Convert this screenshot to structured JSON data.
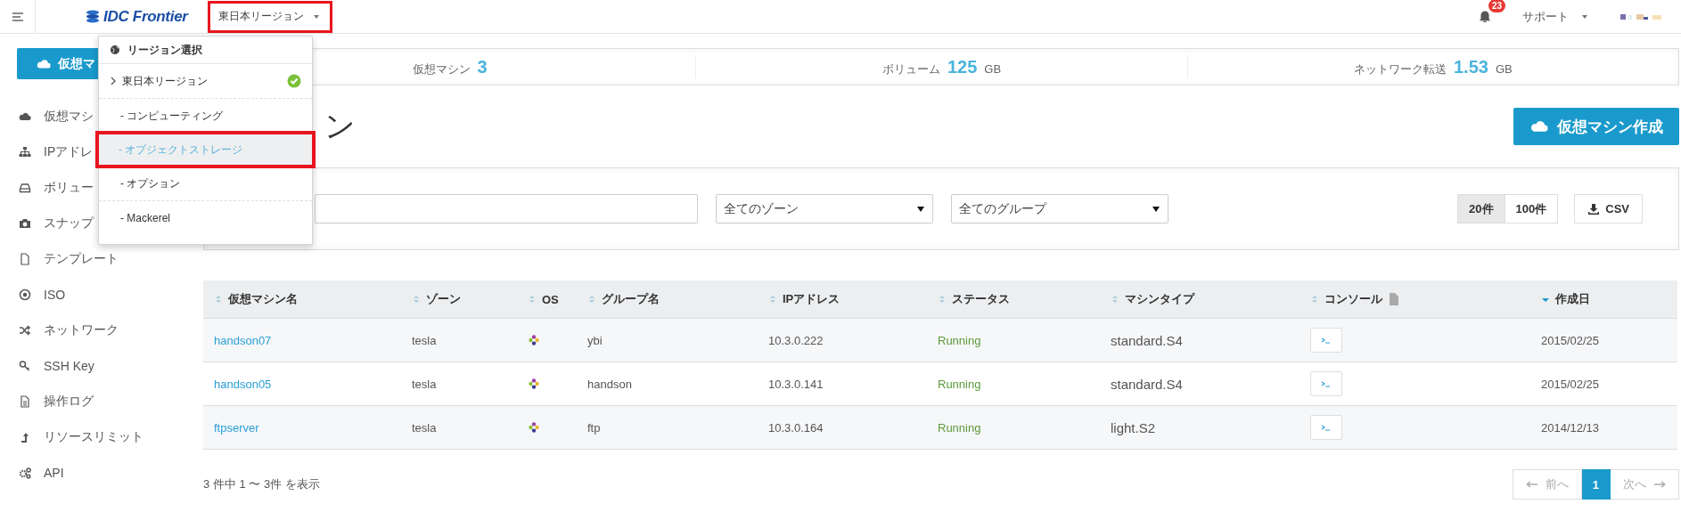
{
  "topbar": {
    "logo_text": "IDC Frontier",
    "region_select": {
      "value": "東日本リージョン",
      "annotated": true
    },
    "notifications": {
      "count": "23"
    },
    "support_menu": {
      "label": "サポート"
    }
  },
  "region_menu": {
    "title": "リージョン選択",
    "items": [
      {
        "kind": "region",
        "label": "東日本リージョン",
        "checked": true,
        "highlighted": false,
        "annotated": false
      },
      {
        "kind": "service",
        "label": "- コンピューティング",
        "checked": false,
        "highlighted": false,
        "annotated": false
      },
      {
        "kind": "service",
        "label": "- オブジェクトストレージ",
        "checked": false,
        "highlighted": true,
        "annotated": true
      },
      {
        "kind": "service",
        "label": "- オプション",
        "checked": false,
        "highlighted": false,
        "annotated": false
      },
      {
        "kind": "service",
        "label": "- Mackerel",
        "checked": false,
        "highlighted": false,
        "annotated": false
      }
    ]
  },
  "sidebar": {
    "create_button": "仮想マ",
    "items": [
      {
        "label": "仮想マシ"
      },
      {
        "label": "IPアドレ"
      },
      {
        "label": "ボリュー"
      },
      {
        "label": "スナップ"
      },
      {
        "label": "テンプレート"
      },
      {
        "label": "ISO"
      },
      {
        "label": "ネットワーク"
      },
      {
        "label": "SSH Key"
      },
      {
        "label": "操作ログ"
      },
      {
        "label": "リソースリミット"
      },
      {
        "label": "API"
      }
    ]
  },
  "stats": [
    {
      "label": "仮想マシン",
      "value": "3"
    },
    {
      "label": "ボリューム",
      "value": "125",
      "unit": "GB"
    },
    {
      "label": "ネットワーク転送",
      "value": "1.53",
      "unit": "GB"
    }
  ],
  "page": {
    "title": "ン",
    "create_button": "仮想マシン作成"
  },
  "filters": {
    "zone_select": "全てのゾーン",
    "group_select": "全てのグループ",
    "page_sizes": [
      {
        "label": "20件",
        "selected": true
      },
      {
        "label": "100件",
        "selected": false
      }
    ],
    "csv_button": "CSV"
  },
  "table": {
    "columns": [
      {
        "label": "仮想マシン名",
        "kind": "link",
        "sorted": false
      },
      {
        "label": "ゾーン",
        "kind": "text",
        "sorted": false
      },
      {
        "label": "OS",
        "kind": "os",
        "sorted": false
      },
      {
        "label": "グループ名",
        "kind": "text",
        "sorted": false
      },
      {
        "label": "IPアドレス",
        "kind": "text",
        "sorted": false
      },
      {
        "label": "ステータス",
        "kind": "status",
        "sorted": false
      },
      {
        "label": "マシンタイプ",
        "kind": "large",
        "sorted": false
      },
      {
        "label": "コンソール",
        "kind": "console",
        "sorted": false
      },
      {
        "label": "作成日",
        "kind": "text",
        "sorted": true
      }
    ],
    "rows": [
      {
        "cells": [
          "handson07",
          "tesla",
          "",
          "ybi",
          "10.3.0.222",
          "Running",
          "standard.S4",
          "",
          "2015/02/25"
        ]
      },
      {
        "cells": [
          "handson05",
          "tesla",
          "",
          "handson",
          "10.3.0.141",
          "Running",
          "standard.S4",
          "",
          "2015/02/25"
        ]
      },
      {
        "cells": [
          "ftpserver",
          "tesla",
          "",
          "ftp",
          "10.3.0.164",
          "Running",
          "light.S2",
          "",
          "2014/12/13"
        ]
      }
    ]
  },
  "footer": {
    "summary": "3 件中 1 〜 3件 を表示",
    "pagination": [
      {
        "label": "前へ",
        "selected": false,
        "disabled": true
      },
      {
        "label": "1",
        "selected": true,
        "disabled": false
      },
      {
        "label": "次へ",
        "selected": false,
        "disabled": true
      }
    ]
  }
}
